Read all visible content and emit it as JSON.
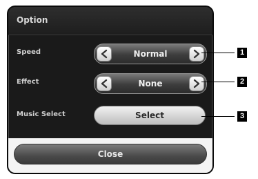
{
  "dialog": {
    "title": "Option"
  },
  "rows": {
    "speed": {
      "label": "Speed",
      "value": "Normal"
    },
    "effect": {
      "label": "Effect",
      "value": "None"
    },
    "music": {
      "label": "Music Select",
      "button": "Select"
    }
  },
  "footer": {
    "close_label": "Close"
  },
  "callouts": {
    "one": "1",
    "two": "2",
    "three": "3"
  }
}
